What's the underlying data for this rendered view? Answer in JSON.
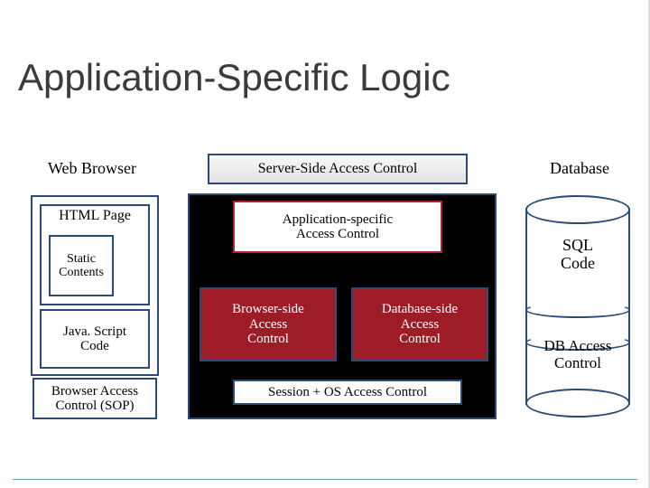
{
  "title": "Application-Specific Logic",
  "columns": {
    "browser": "Web Browser",
    "server": "Server-Side Access Control",
    "database": "Database"
  },
  "browser": {
    "html_page": "HTML Page",
    "static_contents": "Static\nContents",
    "javascript_code": "Java. Script\nCode",
    "sop": "Browser Access\nControl (SOP)"
  },
  "server": {
    "app_specific": "Application-specific\nAccess Control",
    "browser_side": "Browser-side\nAccess\nControl",
    "database_side": "Database-side\nAccess\nControl",
    "session_os": "Session + OS Access Control"
  },
  "database": {
    "sql_code": "SQL\nCode",
    "db_access_control": "DB Access\nControl"
  }
}
